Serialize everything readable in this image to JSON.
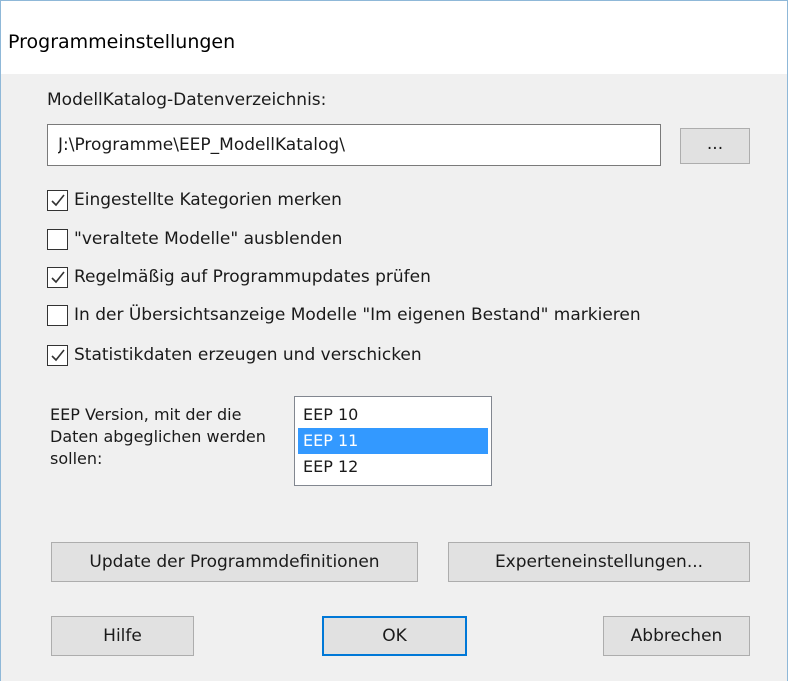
{
  "window": {
    "title": "Programmeinstellungen"
  },
  "directory": {
    "label": "ModellKatalog-Datenverzeichnis:",
    "path": "J:\\Programme\\EEP_ModellKatalog\\",
    "browse_label": "..."
  },
  "options": [
    {
      "label": "Eingestellte Kategorien merken",
      "checked": true
    },
    {
      "label": "\"veraltete Modelle\" ausblenden",
      "checked": false
    },
    {
      "label": "Regelmäßig auf Programmupdates prüfen",
      "checked": true
    },
    {
      "label": "In der Übersichtsanzeige Modelle \"Im eigenen Bestand\" markieren",
      "checked": false
    },
    {
      "label": "Statistikdaten erzeugen und verschicken",
      "checked": true
    }
  ],
  "version": {
    "label": "EEP Version, mit der die Daten abgeglichen werden sollen:",
    "items": [
      "EEP 10",
      "EEP 11",
      "EEP 12"
    ],
    "selected": "EEP 11"
  },
  "buttons": {
    "update": "Update der Programmdefinitionen",
    "expert": "Experteneinstellungen...",
    "help": "Hilfe",
    "ok": "OK",
    "cancel": "Abbrechen"
  },
  "colors": {
    "selection": "#3399ff",
    "accent_border": "#0078d7",
    "dialog_bg": "#f0f0f0"
  }
}
